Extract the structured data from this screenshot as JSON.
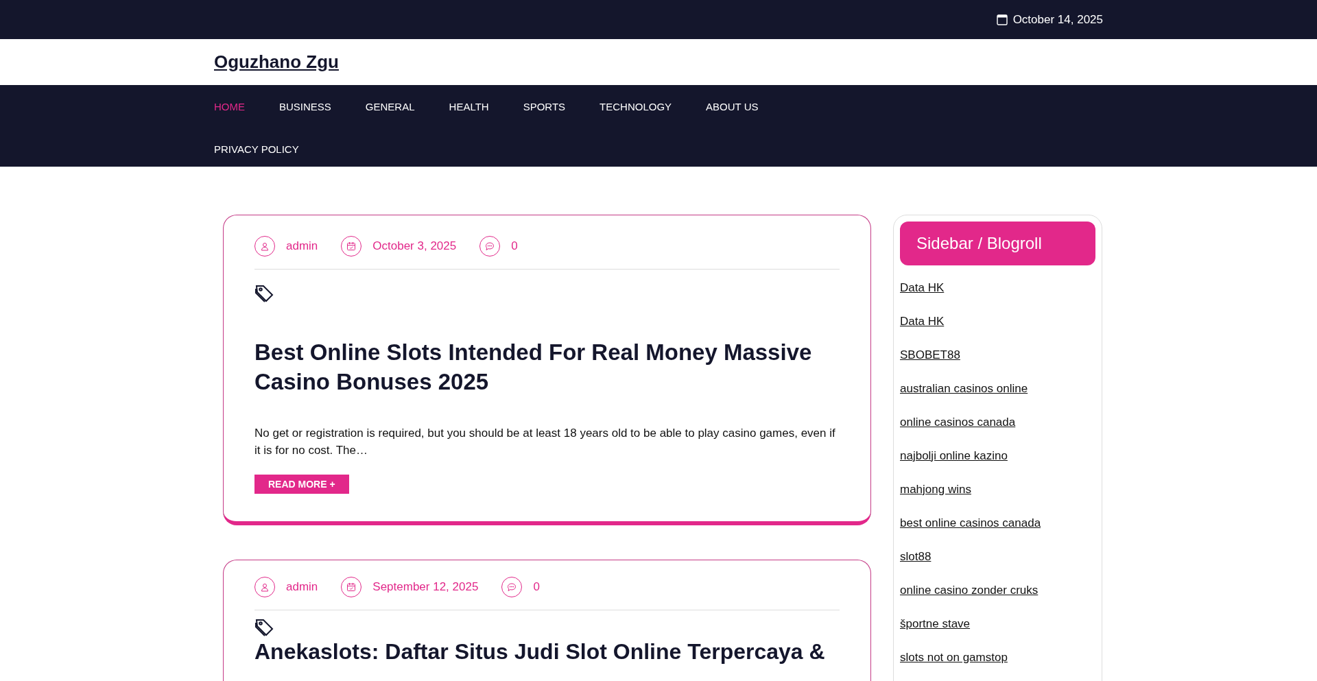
{
  "top_bar": {
    "date": "October 14, 2025"
  },
  "site_title": "Oguzhano Zgu",
  "nav": [
    {
      "label": "HOME",
      "selected": true
    },
    {
      "label": "BUSINESS",
      "selected": false
    },
    {
      "label": "GENERAL",
      "selected": false
    },
    {
      "label": "HEALTH",
      "selected": false
    },
    {
      "label": "SPORTS",
      "selected": false
    },
    {
      "label": "TECHNOLOGY",
      "selected": false
    },
    {
      "label": "ABOUT US",
      "selected": false
    },
    {
      "label": "PRIVACY POLICY",
      "selected": false
    }
  ],
  "posts": [
    {
      "author": "admin",
      "date": "October 3, 2025",
      "comments": "0",
      "title": "Best Online Slots Intended For Real Money Massive Casino Bonuses 2025",
      "excerpt": "No get or registration is required, but you should be at least 18 years old to be able to play casino games, even if it is for no cost. The…",
      "read_more": "READ MORE +"
    },
    {
      "author": "admin",
      "date": "September 12, 2025",
      "comments": "0",
      "title": "Anekaslots: Daftar Situs Judi Slot Online Terpercaya &"
    }
  ],
  "sidebar": {
    "title": "Sidebar / Blogroll",
    "links": [
      "Data HK",
      "Data HK",
      "SBOBET88",
      "australian casinos online",
      "online casinos canada",
      "najbolji online kazino",
      "mahjong wins",
      "best online casinos canada",
      "slot88",
      "online casino zonder cruks",
      "športne stave",
      "slots not on gamstop"
    ]
  }
}
